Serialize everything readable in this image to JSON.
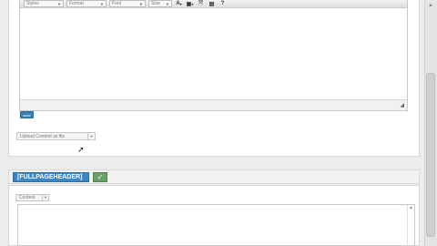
{
  "toolbar": {
    "styles_label": "Styles",
    "format_label": "Format",
    "font_label": "Font",
    "size_label": "Size",
    "text_color_icon": "text-color-icon",
    "bg_color_icon": "background-color-icon",
    "maximize_icon": "maximize-icon",
    "show_blocks_icon": "show-blocks-icon",
    "help_icon": "help-icon"
  },
  "editor1": {
    "save_label": "save"
  },
  "upload": {
    "selected": "Upload Content as file"
  },
  "section": {
    "tag": "[FULLPAGEHEADER]"
  },
  "editor2": {
    "content_selected": "Content"
  },
  "colors": {
    "accent_blue": "#3e86c2",
    "confirm_green": "#6aa06a"
  }
}
